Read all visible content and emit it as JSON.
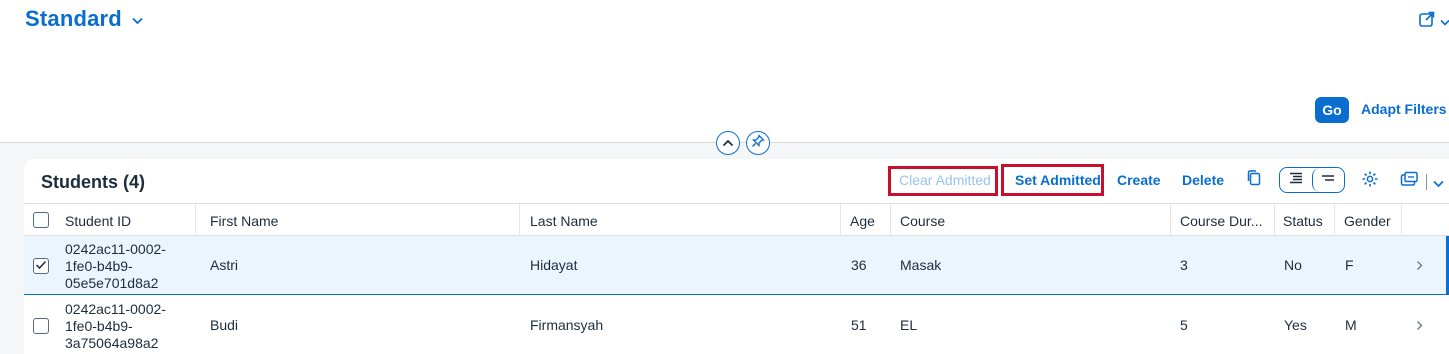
{
  "header": {
    "variant_title": "Standard",
    "go_label": "Go",
    "adapt_filters_label": "Adapt Filters"
  },
  "table": {
    "title": "Students (4)",
    "toolbar": {
      "clear_admitted": "Clear Admitted",
      "set_admitted": "Set Admitted",
      "create": "Create",
      "delete": "Delete"
    },
    "columns": [
      "Student ID",
      "First Name",
      "Last Name",
      "Age",
      "Course",
      "Course Dur...",
      "Status",
      "Gender"
    ],
    "rows": [
      {
        "selected": true,
        "student_id": "0242ac11-0002-\n1fe0-b4b9-\n05e5e701d8a2",
        "first_name": "Astri",
        "last_name": "Hidayat",
        "age": "36",
        "course": "Masak",
        "course_duration": "3",
        "status": "No",
        "gender": "F"
      },
      {
        "selected": false,
        "student_id": "0242ac11-0002-\n1fe0-b4b9-\n3a75064a98a2",
        "first_name": "Budi",
        "last_name": "Firmansyah",
        "age": "51",
        "course": "EL",
        "course_duration": "5",
        "status": "Yes",
        "gender": "M"
      }
    ]
  },
  "colors": {
    "accent": "#0a6ed1",
    "highlight_box": "#c8102e",
    "selected_row_bg": "#ebf5fe"
  },
  "icons": [
    "chevron-down-icon",
    "share-icon",
    "collapse-header-icon",
    "pin-icon",
    "copy-icon",
    "condensed-view-icon",
    "compact-view-icon",
    "settings-icon",
    "export-icon",
    "checkmark-icon",
    "chevron-right-icon"
  ]
}
